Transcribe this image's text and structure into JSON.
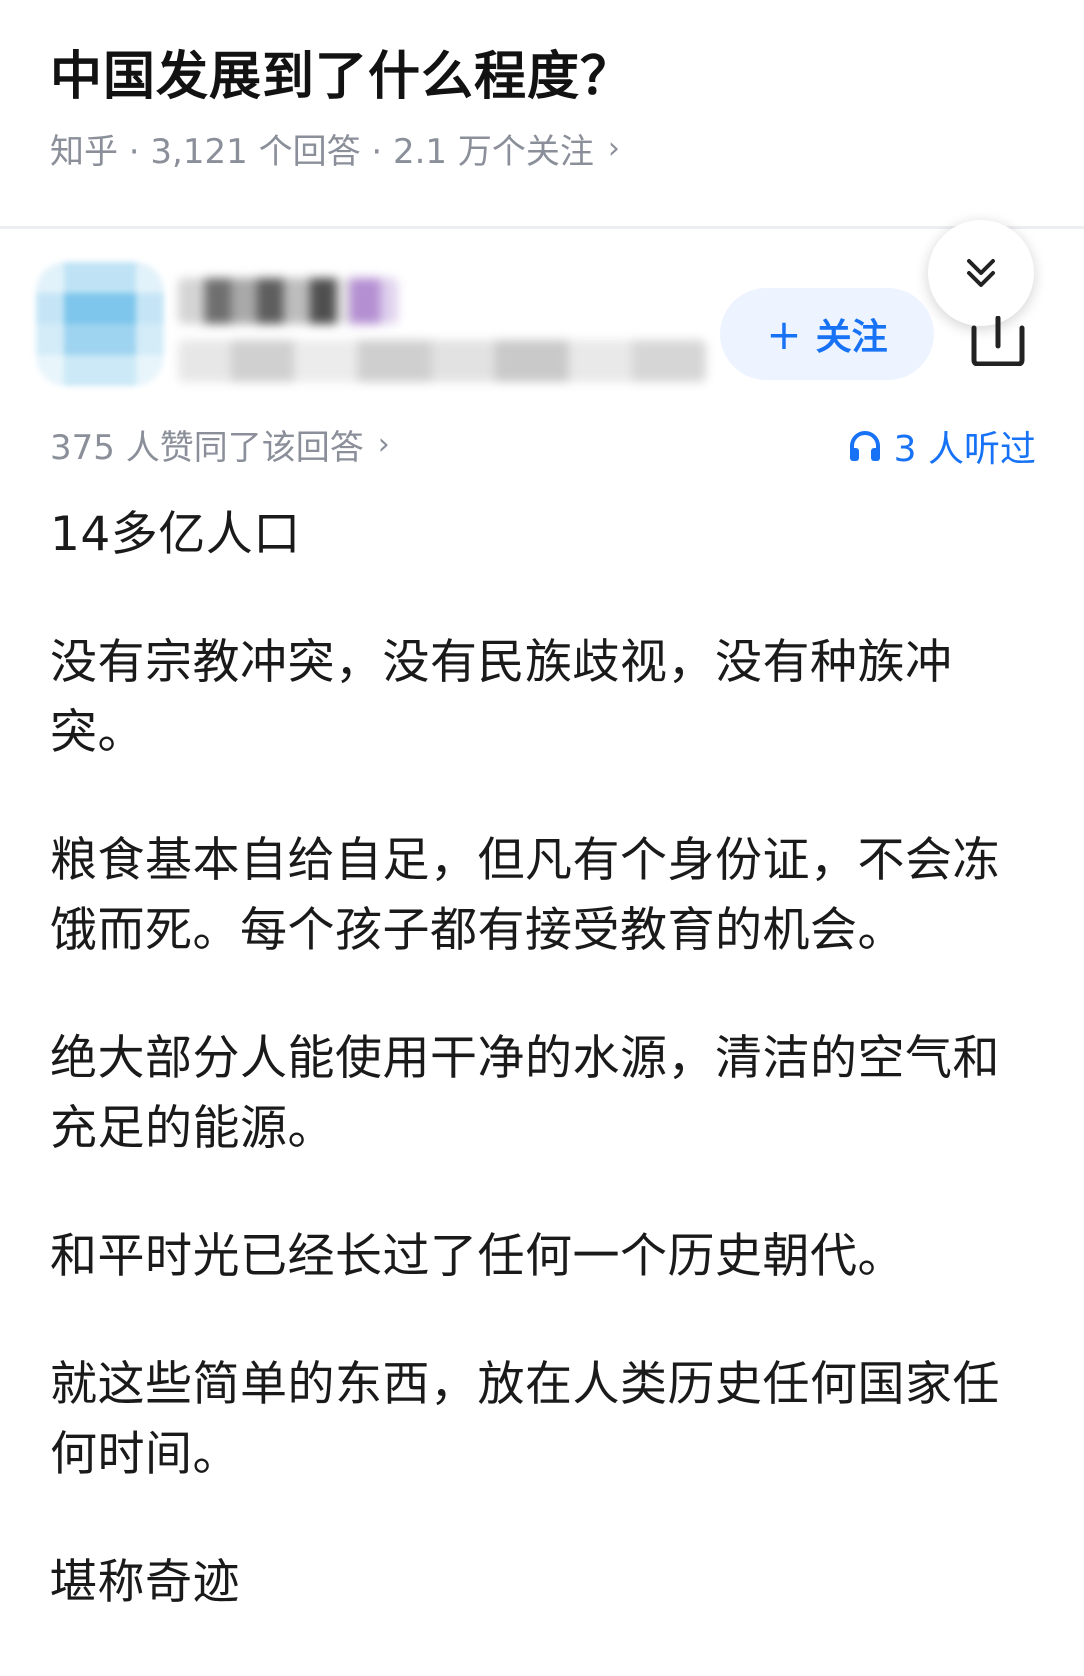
{
  "question": {
    "title": "中国发展到了什么程度？",
    "meta": "知乎 · 3,121 个回答 · 2.1 万个关注"
  },
  "author": {
    "follow_label": "关注"
  },
  "stats": {
    "likes": "375 人赞同了该回答",
    "listeners": "3 人听过"
  },
  "icons": {
    "collapse": "double-chevron-down-icon",
    "share": "share-icon",
    "headphones": "headphones-icon"
  },
  "colors": {
    "accent": "#1772f6",
    "muted": "#8a8f99"
  },
  "answer": {
    "paragraphs": [
      "14多亿人口",
      "没有宗教冲突，没有民族歧视，没有种族冲突。",
      "粮食基本自给自足，但凡有个身份证，不会冻饿而死。每个孩子都有接受教育的机会。",
      "绝大部分人能使用干净的水源，清洁的空气和充足的能源。",
      "和平时光已经长过了任何一个历史朝代。",
      "就这些简单的东西，放在人类历史任何国家任何时间。",
      "堪称奇迹"
    ]
  }
}
